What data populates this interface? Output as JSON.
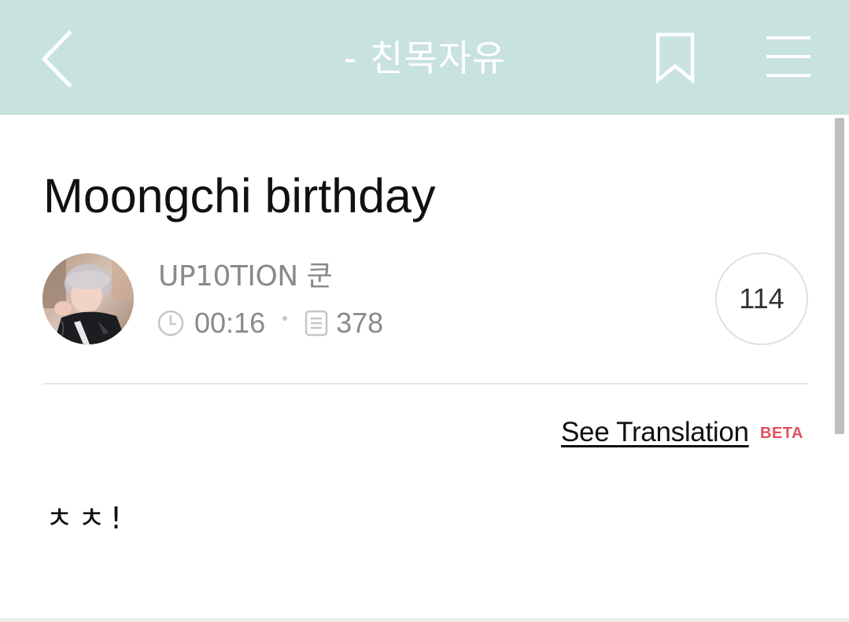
{
  "header": {
    "title": "- 친목자유",
    "back_icon": "chevron-left-icon",
    "bookmark_icon": "bookmark-icon",
    "menu_icon": "hamburger-menu-icon",
    "background_color": "#c7e2df"
  },
  "post": {
    "title": "Moongchi birthday",
    "author": "UP10TION 쿤",
    "time": "00:16",
    "views": "378",
    "likes": "114",
    "translation_link": "See Translation",
    "translation_badge": "BETA",
    "body": "ㅊㅊ!"
  },
  "colors": {
    "meta_text": "#8a8a8a",
    "beta_badge": "#e0515d"
  }
}
